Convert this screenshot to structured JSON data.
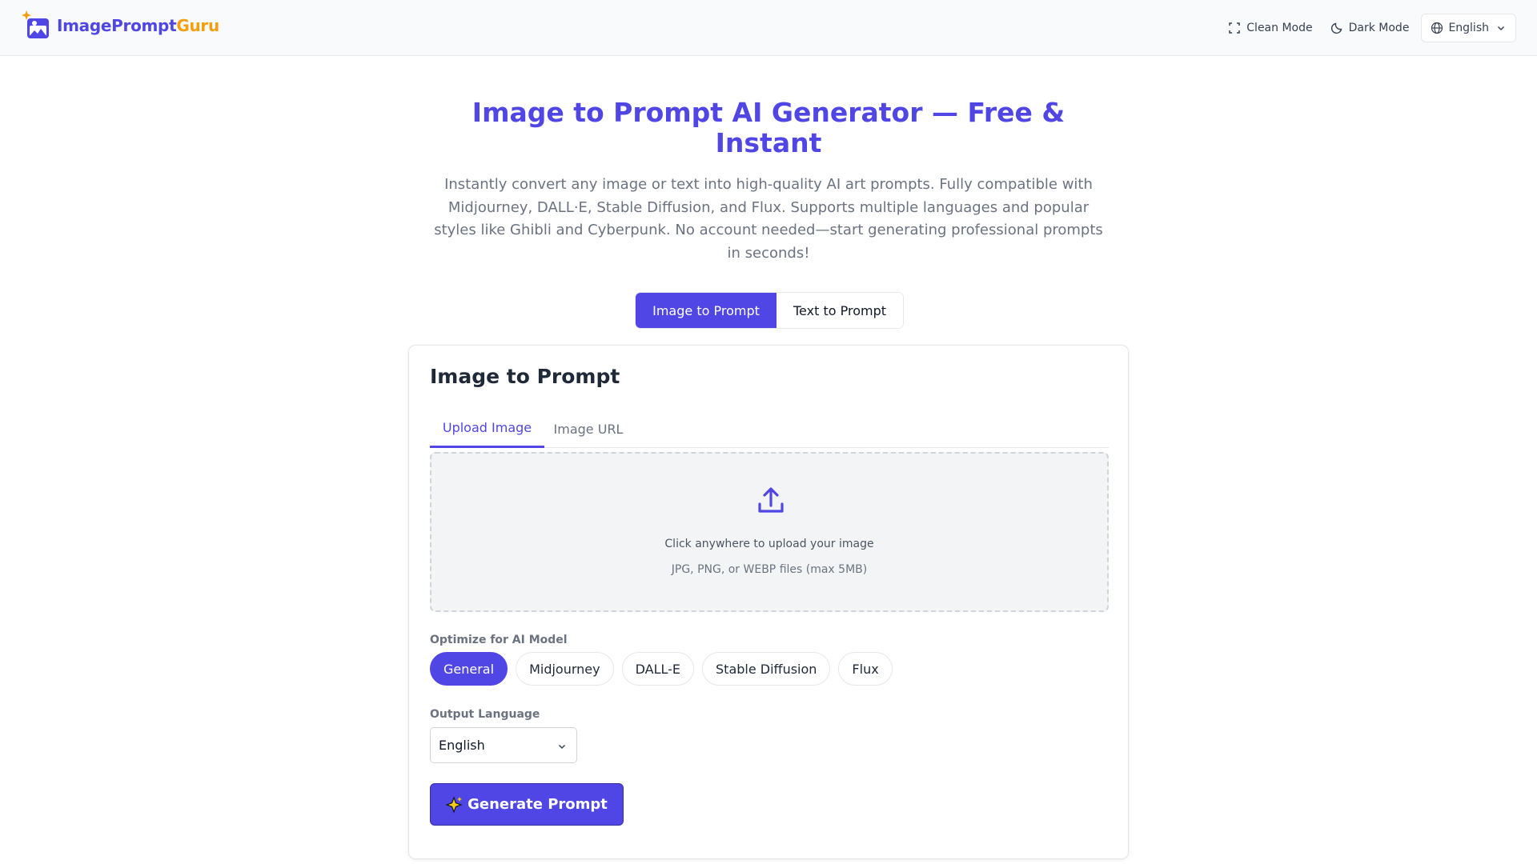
{
  "brand": {
    "name_part1": "ImagePrompt",
    "name_part2": "Guru",
    "color_primary": "#4f46e5",
    "color_accent": "#f59e0b"
  },
  "topbar": {
    "clean_mode_label": "Clean Mode",
    "dark_mode_label": "Dark Mode",
    "language_label": "English",
    "icons": [
      "fullscreen-icon",
      "moon-icon",
      "globe-icon",
      "chevron-down-icon"
    ]
  },
  "hero": {
    "title": "Image to Prompt AI Generator — Free & Instant",
    "subtitle": "Instantly convert any image or text into high-quality AI art prompts. Fully compatible with Midjourney, DALL·E, Stable Diffusion, and Flux. Supports multiple languages and popular styles like Ghibli and Cyberpunk. No account needed—start generating professional prompts in seconds!"
  },
  "mode_tabs": {
    "active": "Image to Prompt",
    "inactive": "Text to Prompt"
  },
  "card": {
    "title": "Image to Prompt",
    "subtabs": {
      "active": "Upload Image",
      "inactive": "Image URL"
    },
    "dropzone": {
      "main_text": "Click anywhere to upload your image",
      "sub_text": "JPG, PNG, or WEBP files (max 5MB)",
      "icon": "upload-icon"
    },
    "model_label": "Optimize for AI Model",
    "models": [
      "General",
      "Midjourney",
      "DALL-E",
      "Stable Diffusion",
      "Flux"
    ],
    "selected_model": "General",
    "language_label": "Output Language",
    "language_value": "English",
    "generate_label": "Generate Prompt",
    "generate_icon": "sparkles-icon"
  }
}
